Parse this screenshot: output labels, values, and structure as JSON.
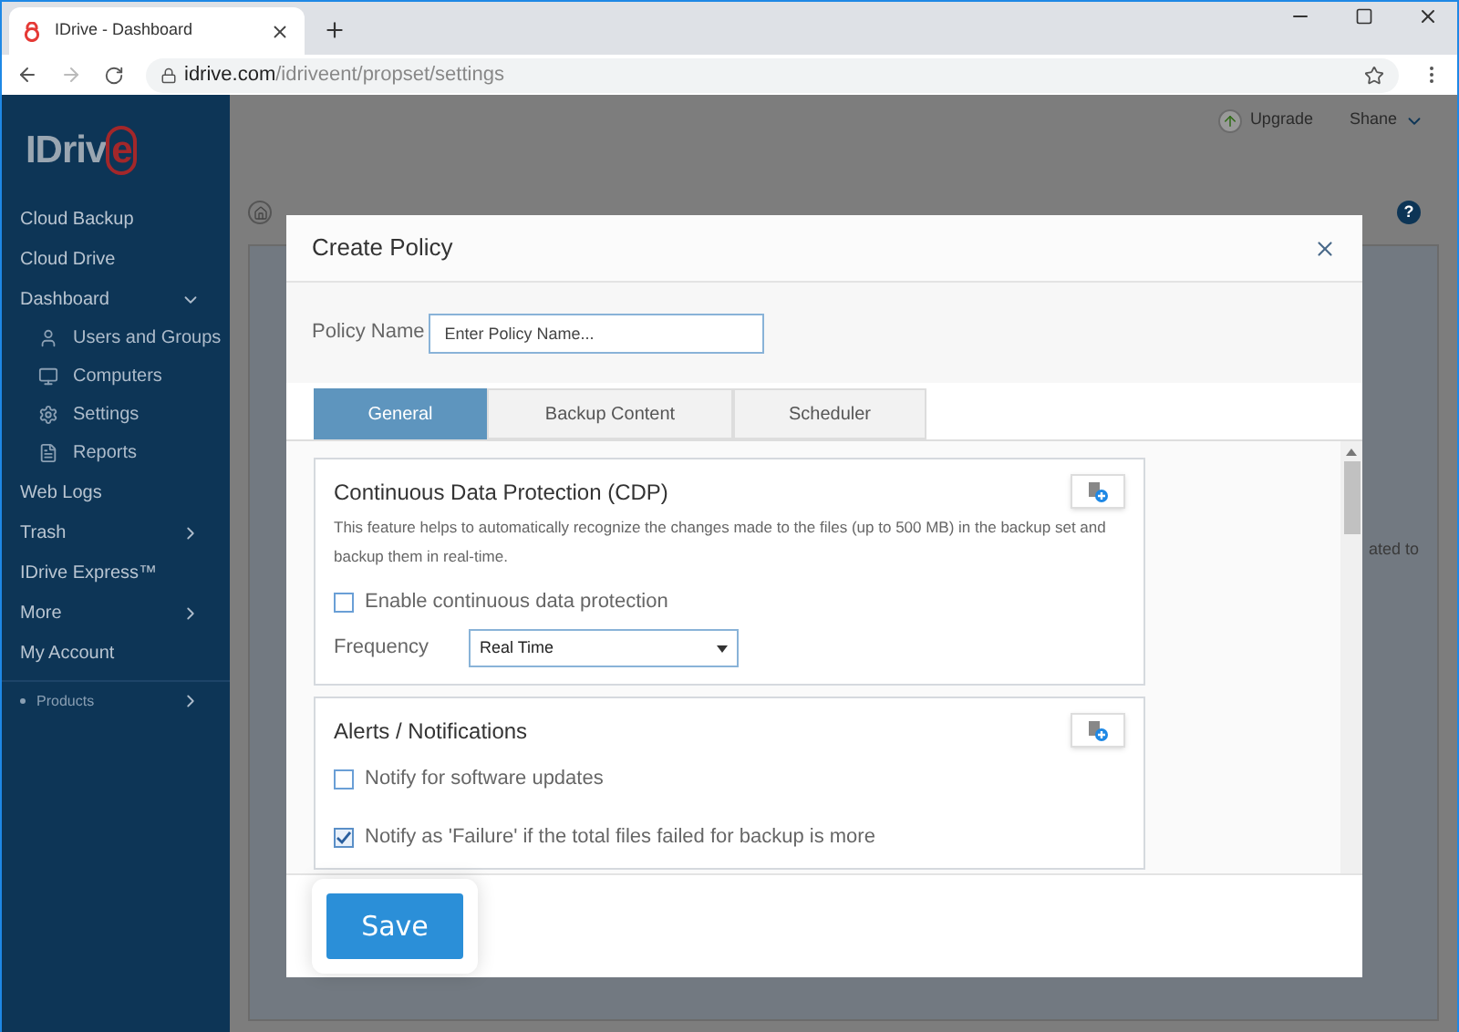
{
  "browser": {
    "tab_title": "IDrive - Dashboard",
    "url_host": "idrive.com",
    "url_path": "/idriveent/propset/settings"
  },
  "sidebar": {
    "logo": "IDriv",
    "logo_e": "e",
    "items": [
      {
        "label": "Cloud Backup",
        "kind": "item"
      },
      {
        "label": "Cloud Drive",
        "kind": "item"
      },
      {
        "label": "Dashboard",
        "kind": "group",
        "expanded": true
      },
      {
        "label": "Users and Groups",
        "kind": "sub"
      },
      {
        "label": "Computers",
        "kind": "sub"
      },
      {
        "label": "Settings",
        "kind": "sub"
      },
      {
        "label": "Reports",
        "kind": "sub"
      },
      {
        "label": "Web Logs",
        "kind": "item"
      },
      {
        "label": "Trash",
        "kind": "group",
        "expanded": false
      },
      {
        "label": "IDrive Express™",
        "kind": "item"
      },
      {
        "label": "More",
        "kind": "group",
        "expanded": false
      },
      {
        "label": "My Account",
        "kind": "item"
      },
      {
        "label": "Products",
        "kind": "footer"
      }
    ]
  },
  "header": {
    "upgrade": "Upgrade",
    "user": "Shane",
    "help": "?"
  },
  "background_text": "ated to",
  "dialog": {
    "title": "Create Policy",
    "policy_name_label": "Policy Name",
    "policy_name_placeholder": "Enter Policy Name...",
    "tabs": [
      {
        "label": "General",
        "selected": true
      },
      {
        "label": "Backup Content",
        "selected": false
      },
      {
        "label": "Scheduler",
        "selected": false
      }
    ],
    "sections": [
      {
        "title": "Continuous Data Protection (CDP)",
        "description": "This feature helps to automatically recognize the changes made to the files (up to 500 MB) in the backup set and backup them in real-time.",
        "options": [
          {
            "label": "Enable continuous data protection",
            "checked": false
          }
        ],
        "frequency_label": "Frequency",
        "frequency_value": "Real Time"
      },
      {
        "title": "Alerts / Notifications",
        "options": [
          {
            "label": "Notify for software updates",
            "checked": false
          },
          {
            "label": "Notify as 'Failure' if the total files failed for backup is more",
            "checked": true
          }
        ]
      }
    ],
    "save": "Save"
  }
}
